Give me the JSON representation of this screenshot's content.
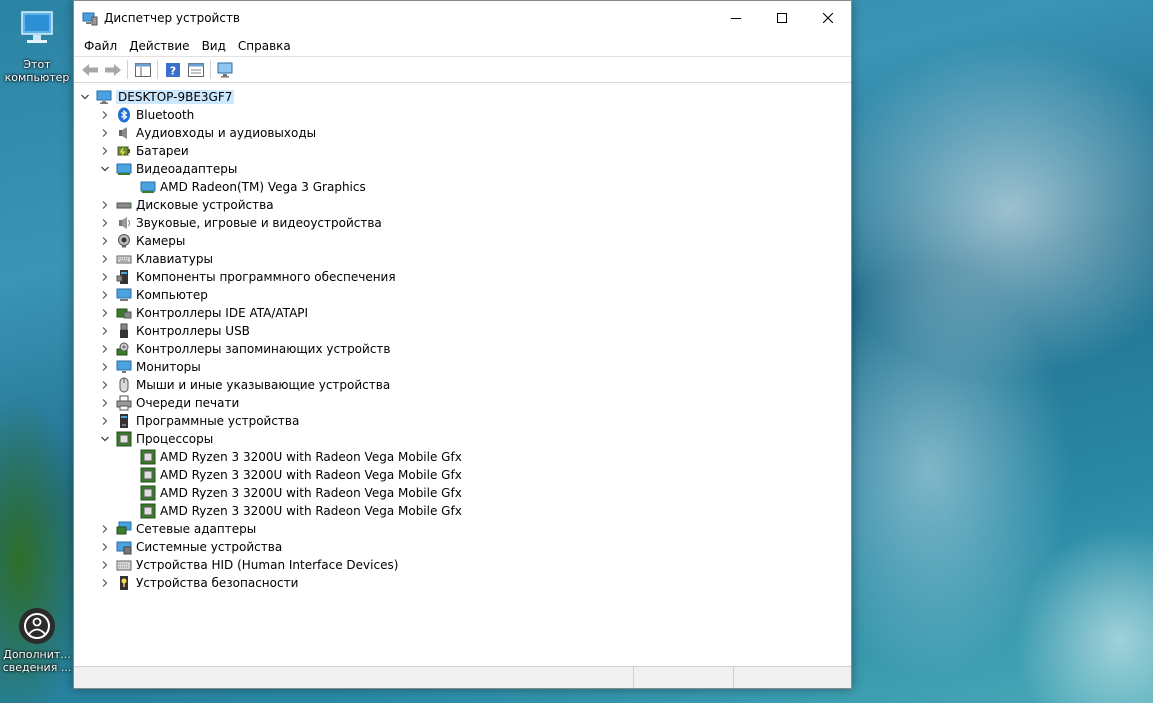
{
  "desktop": {
    "this_pc_line1": "Этот",
    "this_pc_line2": "компьютер",
    "extra_line1": "Дополнит...",
    "extra_line2": "сведения ..."
  },
  "window": {
    "title": "Диспетчер устройств",
    "menu": [
      "Файл",
      "Действие",
      "Вид",
      "Справка"
    ]
  },
  "tree": {
    "root": "DESKTOP-9BE3GF7",
    "items": [
      {
        "label": "Bluetooth",
        "icon": "bluetooth-icon",
        "expanded": false
      },
      {
        "label": "Аудиовходы и аудиовыходы",
        "icon": "speaker-icon",
        "expanded": false
      },
      {
        "label": "Батареи",
        "icon": "battery-icon",
        "expanded": false
      },
      {
        "label": "Видеоадаптеры",
        "icon": "display-adapter-icon",
        "expanded": true,
        "children": [
          "AMD Radeon(TM) Vega 3 Graphics"
        ]
      },
      {
        "label": "Дисковые устройства",
        "icon": "disk-drive-icon",
        "expanded": false
      },
      {
        "label": "Звуковые, игровые и видеоустройства",
        "icon": "sound-device-icon",
        "expanded": false
      },
      {
        "label": "Камеры",
        "icon": "camera-icon",
        "expanded": false
      },
      {
        "label": "Клавиатуры",
        "icon": "keyboard-icon",
        "expanded": false
      },
      {
        "label": "Компоненты программного обеспечения",
        "icon": "software-component-icon",
        "expanded": false
      },
      {
        "label": "Компьютер",
        "icon": "computer-icon",
        "expanded": false
      },
      {
        "label": "Контроллеры IDE ATA/ATAPI",
        "icon": "ide-controller-icon",
        "expanded": false
      },
      {
        "label": "Контроллеры USB",
        "icon": "usb-icon",
        "expanded": false
      },
      {
        "label": "Контроллеры запоминающих устройств",
        "icon": "storage-controller-icon",
        "expanded": false
      },
      {
        "label": "Мониторы",
        "icon": "monitor-icon",
        "expanded": false
      },
      {
        "label": "Мыши и иные указывающие устройства",
        "icon": "mouse-icon",
        "expanded": false
      },
      {
        "label": "Очереди печати",
        "icon": "printer-icon",
        "expanded": false
      },
      {
        "label": "Программные устройства",
        "icon": "software-device-icon",
        "expanded": false
      },
      {
        "label": "Процессоры",
        "icon": "processor-icon",
        "expanded": true,
        "children": [
          "AMD Ryzen 3 3200U with Radeon Vega Mobile Gfx",
          "AMD Ryzen 3 3200U with Radeon Vega Mobile Gfx",
          "AMD Ryzen 3 3200U with Radeon Vega Mobile Gfx",
          "AMD Ryzen 3 3200U with Radeon Vega Mobile Gfx"
        ]
      },
      {
        "label": "Сетевые адаптеры",
        "icon": "network-adapter-icon",
        "expanded": false
      },
      {
        "label": "Системные устройства",
        "icon": "system-device-icon",
        "expanded": false
      },
      {
        "label": "Устройства HID (Human Interface Devices)",
        "icon": "hid-icon",
        "expanded": false
      },
      {
        "label": "Устройства безопасности",
        "icon": "security-device-icon",
        "expanded": false
      }
    ]
  },
  "colors": {
    "selection": "#cce8ff",
    "accent": "#0078d7"
  }
}
